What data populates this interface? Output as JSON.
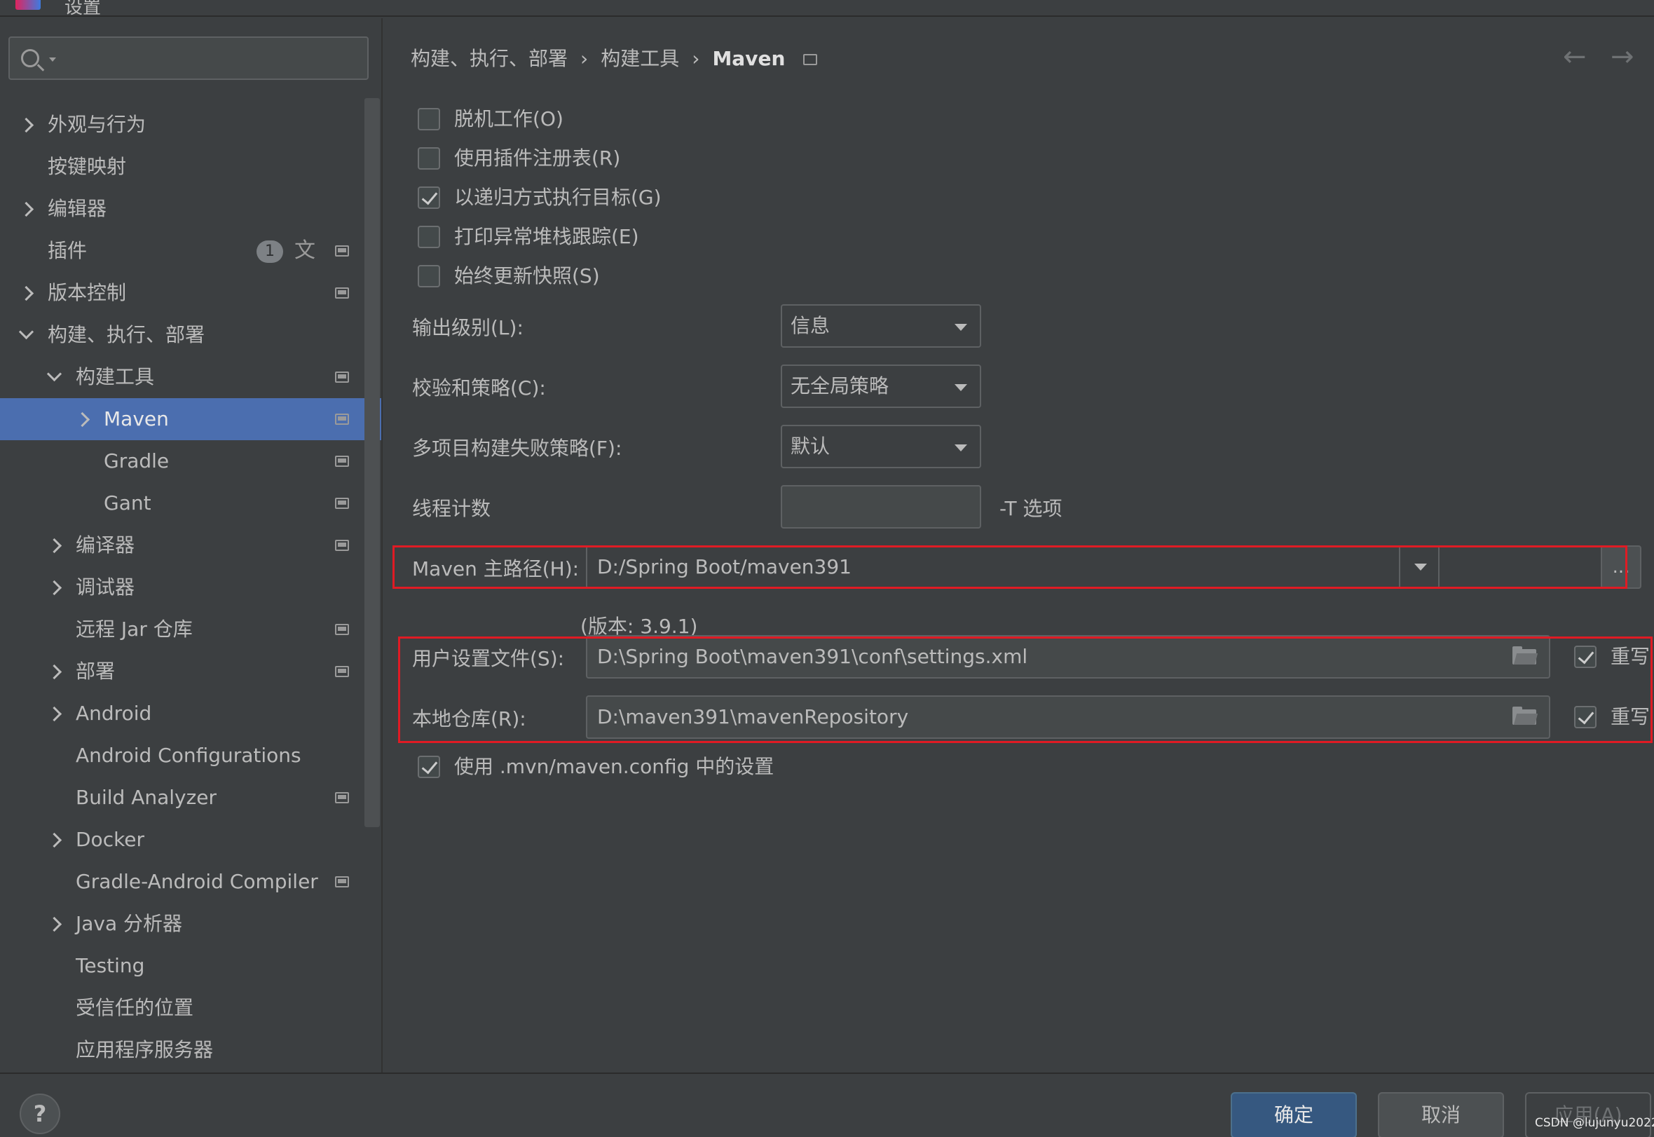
{
  "window": {
    "title": "设置"
  },
  "search": {
    "placeholder": ""
  },
  "sidebar": {
    "items": [
      {
        "label": "外观与行为",
        "level": 0,
        "expander": "closed"
      },
      {
        "label": "按键映射",
        "level": 0,
        "expander": "none"
      },
      {
        "label": "编辑器",
        "level": 0,
        "expander": "closed"
      },
      {
        "label": "插件",
        "level": 0,
        "expander": "none",
        "badge": "1"
      },
      {
        "label": "版本控制",
        "level": 0,
        "expander": "closed"
      },
      {
        "label": "构建、执行、部署",
        "level": 0,
        "expander": "open"
      },
      {
        "label": "构建工具",
        "level": 1,
        "expander": "open"
      },
      {
        "label": "Maven",
        "level": 2,
        "expander": "closed",
        "selected": true
      },
      {
        "label": "Gradle",
        "level": 2,
        "expander": "none"
      },
      {
        "label": "Gant",
        "level": 2,
        "expander": "none"
      },
      {
        "label": "编译器",
        "level": 1,
        "expander": "closed"
      },
      {
        "label": "调试器",
        "level": 1,
        "expander": "closed"
      },
      {
        "label": "远程 Jar 仓库",
        "level": 1,
        "expander": "none"
      },
      {
        "label": "部署",
        "level": 1,
        "expander": "closed"
      },
      {
        "label": "Android",
        "level": 1,
        "expander": "closed"
      },
      {
        "label": "Android Configurations",
        "level": 1,
        "expander": "none"
      },
      {
        "label": "Build Analyzer",
        "level": 1,
        "expander": "none"
      },
      {
        "label": "Docker",
        "level": 1,
        "expander": "closed"
      },
      {
        "label": "Gradle-Android Compiler",
        "level": 1,
        "expander": "none"
      },
      {
        "label": "Java 分析器",
        "level": 1,
        "expander": "closed"
      },
      {
        "label": "Testing",
        "level": 1,
        "expander": "none"
      },
      {
        "label": "受信任的位置",
        "level": 1,
        "expander": "none"
      },
      {
        "label": "应用程序服务器",
        "level": 1,
        "expander": "none"
      }
    ]
  },
  "breadcrumb": {
    "parts": [
      "构建、执行、部署",
      "构建工具"
    ],
    "current": "Maven",
    "separator": "›"
  },
  "nav": {
    "back": "←",
    "forward": "→"
  },
  "options": {
    "offline": {
      "label": "脱机工作(O)",
      "checked": false
    },
    "plugin_registry": {
      "label": "使用插件注册表(R)",
      "checked": false
    },
    "recursive": {
      "label": "以递归方式执行目标(G)",
      "checked": true
    },
    "stack_trace": {
      "label": "打印异常堆栈跟踪(E)",
      "checked": false
    },
    "update_snapshots": {
      "label": "始终更新快照(S)",
      "checked": false
    }
  },
  "form": {
    "output_level": {
      "label": "输出级别(L):",
      "value": "信息"
    },
    "checksum_policy": {
      "label": "校验和策略(C):",
      "value": "无全局策略"
    },
    "fail_policy": {
      "label": "多项目构建失败策略(F):",
      "value": "默认"
    },
    "thread_count": {
      "label": "线程计数",
      "value": "",
      "hint": "-T 选项"
    },
    "maven_home": {
      "label": "Maven 主路径(H):",
      "value": "D:/Spring Boot/maven391",
      "browse": "...",
      "version": "(版本: 3.9.1)"
    },
    "user_settings": {
      "label": "用户设置文件(S):",
      "value": "D:\\Spring Boot\\maven391\\conf\\settings.xml",
      "override_label": "重写",
      "override": true
    },
    "local_repo": {
      "label": "本地仓库(R):",
      "value": "D:\\maven391\\mavenRepository",
      "override_label": "重写",
      "override": true
    },
    "use_mvn_config": {
      "label": "使用 .mvn/maven.config 中的设置",
      "checked": true
    }
  },
  "buttons": {
    "help": "?",
    "ok": "确定",
    "cancel": "取消",
    "apply": "应用(A)"
  },
  "watermark": "CSDN @lujunyu2022",
  "colors": {
    "selection": "#4b6eaf",
    "primary_button": "#365880",
    "highlight_box": "#e01b24",
    "background": "#3c3f41"
  }
}
